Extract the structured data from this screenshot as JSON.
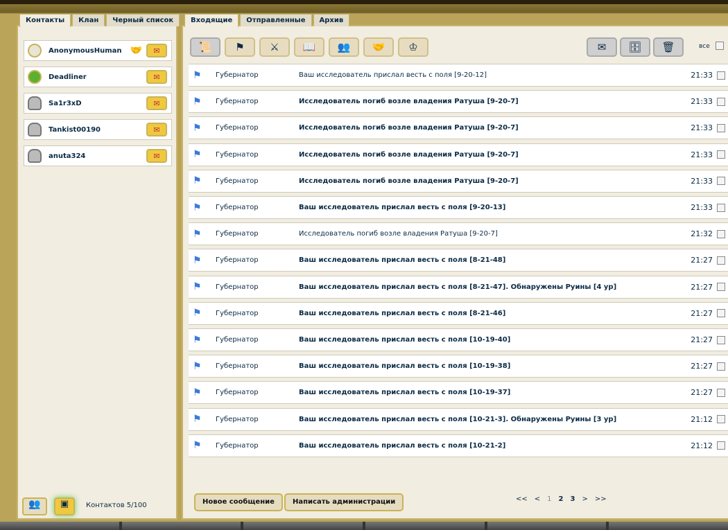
{
  "left_tabs": [
    "Контакты",
    "Клан",
    "Черный список"
  ],
  "contacts": [
    {
      "name": "AnonymousHuman",
      "status": "neutral",
      "ally": true
    },
    {
      "name": "Deadliner",
      "status": "online"
    },
    {
      "name": "Sa1r3xD",
      "status": "locked"
    },
    {
      "name": "Tankist00190",
      "status": "locked"
    },
    {
      "name": "anuta324",
      "status": "locked"
    }
  ],
  "contacts_count": "Контактов 5/100",
  "right_tabs": [
    "Входящие",
    "Отправленные",
    "Архив"
  ],
  "select_all_label": "все",
  "messages": [
    {
      "from": "Губернатор",
      "subject": "Ваш исследователь прислал весть с поля [9-20-12]",
      "time": "21:33",
      "unread": false
    },
    {
      "from": "Губернатор",
      "subject": "Исследователь погиб возле владения Ратуша [9-20-7]",
      "time": "21:33",
      "unread": true
    },
    {
      "from": "Губернатор",
      "subject": "Исследователь погиб возле владения Ратуша [9-20-7]",
      "time": "21:33",
      "unread": true
    },
    {
      "from": "Губернатор",
      "subject": "Исследователь погиб возле владения Ратуша [9-20-7]",
      "time": "21:33",
      "unread": true
    },
    {
      "from": "Губернатор",
      "subject": "Исследователь погиб возле владения Ратуша [9-20-7]",
      "time": "21:33",
      "unread": true
    },
    {
      "from": "Губернатор",
      "subject": "Ваш исследователь прислал весть с поля [9-20-13]",
      "time": "21:33",
      "unread": true
    },
    {
      "from": "Губернатор",
      "subject": "Исследователь погиб возле владения Ратуша [9-20-7]",
      "time": "21:32",
      "unread": false
    },
    {
      "from": "Губернатор",
      "subject": "Ваш исследователь прислал весть с поля [8-21-48]",
      "time": "21:27",
      "unread": true
    },
    {
      "from": "Губернатор",
      "subject": "Ваш исследователь прислал весть с поля [8-21-47]. Обнаружены Руины [4 ур]",
      "time": "21:27",
      "unread": true
    },
    {
      "from": "Губернатор",
      "subject": "Ваш исследователь прислал весть с поля [8-21-46]",
      "time": "21:27",
      "unread": true
    },
    {
      "from": "Губернатор",
      "subject": "Ваш исследователь прислал весть с поля [10-19-40]",
      "time": "21:27",
      "unread": true
    },
    {
      "from": "Губернатор",
      "subject": "Ваш исследователь прислал весть с поля [10-19-38]",
      "time": "21:27",
      "unread": true
    },
    {
      "from": "Губернатор",
      "subject": "Ваш исследователь прислал весть с поля [10-19-37]",
      "time": "21:27",
      "unread": true
    },
    {
      "from": "Губернатор",
      "subject": "Ваш исследователь прислал весть с поля [10-21-3]. Обнаружены Руины [3 ур]",
      "time": "21:12",
      "unread": true
    },
    {
      "from": "Губернатор",
      "subject": "Ваш исследователь прислал весть с поля [10-21-2]",
      "time": "21:12",
      "unread": true
    }
  ],
  "buttons": {
    "new_message": "Новое сообщение",
    "write_admin": "Написать администрации"
  },
  "pager": {
    "first": "<<",
    "prev": "<",
    "pages": [
      "1",
      "2",
      "3"
    ],
    "current": "1",
    "next": ">",
    "last": ">>"
  }
}
